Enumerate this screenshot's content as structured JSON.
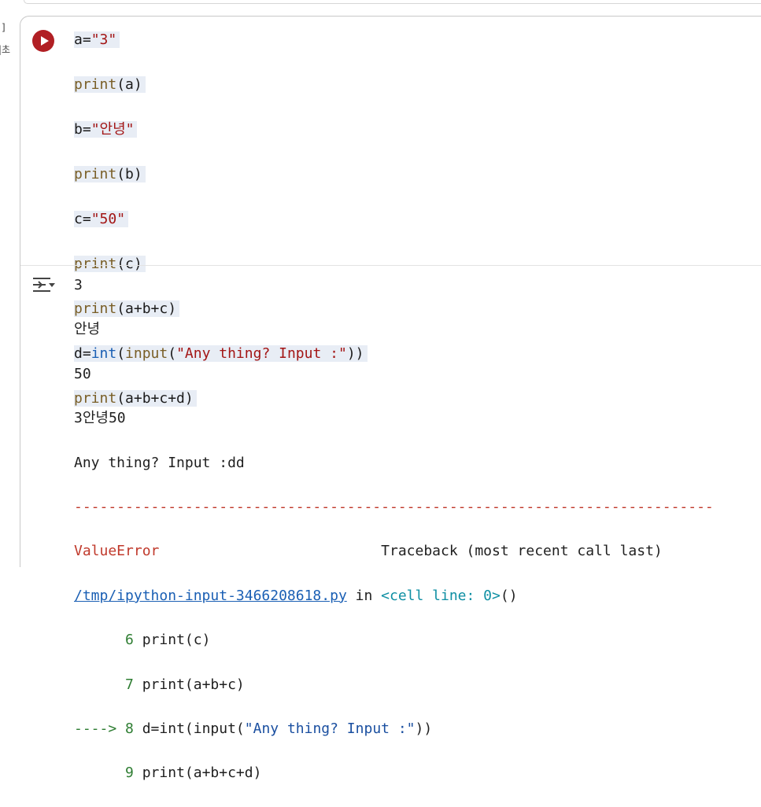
{
  "gutter": {
    "bracket": "]",
    "exec_time_fragment": "|초"
  },
  "run_button": {
    "icon": "play-icon",
    "color": "#b11f24"
  },
  "code_lines": [
    "a=\"3\"",
    "print(a)",
    "b=\"안녕\"",
    "print(b)",
    "c=\"50\"",
    "print(c)",
    "print(a+b+c)",
    "d=int(input(\"Any thing? Input :\"))",
    "print(a+b+c+d)"
  ],
  "output_icon": "output-toggle-icon",
  "output": {
    "lines": [
      "3",
      "안녕",
      "50",
      "3안녕50",
      "Any thing? Input :dd"
    ],
    "dashes": "---------------------------------------------------------------------------",
    "error_name": "ValueError",
    "traceback_header": "Traceback (most recent call last)",
    "file_link": "/tmp/ipython-input-3466208618.py",
    "in_word": " in ",
    "cell_ref": "<cell line: 0>",
    "cell_ref_suffix": "()",
    "trace_lines": [
      {
        "prefix": "      ",
        "num": "6",
        "code": "print(c)"
      },
      {
        "prefix": "      ",
        "num": "7",
        "code": "print(a+b+c)"
      },
      {
        "prefix": "----> ",
        "num": "8",
        "code_before": "d=int(input(",
        "code_str": "\"Any thing? Input :\"",
        "code_after": "))"
      },
      {
        "prefix": "      ",
        "num": "9",
        "code": "print(a+b+c+d)"
      }
    ]
  }
}
